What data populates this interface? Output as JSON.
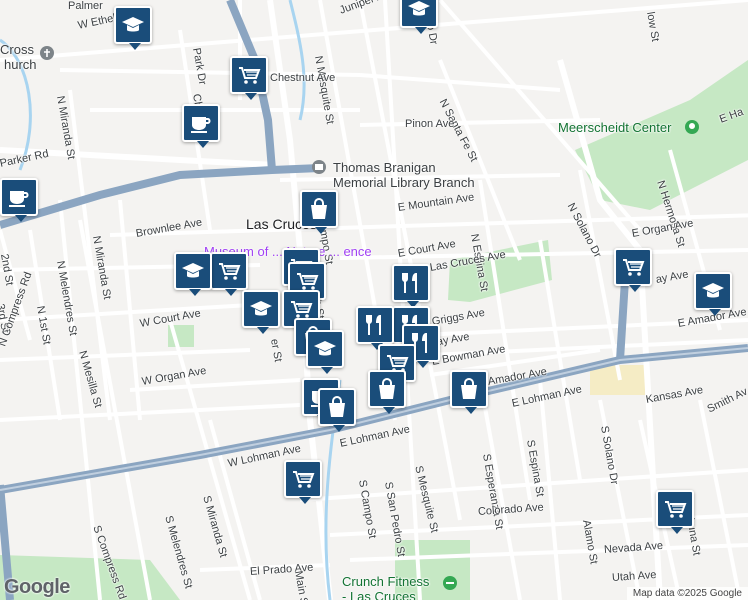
{
  "map": {
    "city_label": "Las Cruces",
    "museum_label": "Museum of ... Nature ... ence",
    "library_label_line1": "Thomas Branigan",
    "library_label_line2": "Memorial Library Branch",
    "meerscheidt_label": "Meerscheidt Center",
    "crunch_label_line1": "Crunch Fitness",
    "crunch_label_line2": "- Las Cruces",
    "cross_label_line1": "Cross",
    "cross_label_line2": "hurch",
    "google_logo": "Google",
    "attribution": "Map data ©2025 Google",
    "colors": {
      "pin": "#1a4d7a",
      "park": "#c6e8c4",
      "highway": "#8ba5c1",
      "water": "#a8d4f0"
    }
  },
  "streets": {
    "palmer": "Palmer",
    "w_ethel": "W Ethel",
    "juniper": "Juniper Ave",
    "n_mesquite": "N Mesquite St",
    "park_dr": "Park Dr",
    "chestnut": "Chestnut Ave",
    "n_miranda_top": "N Miranda St",
    "cher": "Cher",
    "n_santa_fe": "N Santa Fe St",
    "pinon": "Pinon Ave",
    "parker": "Parker Rd",
    "n_solano": "N Solano Dr",
    "n_hermosa": "N Hermosa St",
    "e_mountain": "E Mountain Ave",
    "n_espina": "N Espina St",
    "e_organ": "E Organ Ave",
    "brownlee": "Brownlee Ave",
    "n_miranda": "N Miranda St",
    "n_melendres": "N Melendres St",
    "2nd": "2nd St",
    "3rd": "3rd St",
    "n_1st": "N 1st St",
    "n_compress": "N Compress Rd",
    "n_mesilla": "N Mesilla St",
    "w_court": "W Court Ave",
    "e_court": "E Court Ave",
    "las_cruces_ave": "Las Cruces Ave",
    "e_amador": "E Amador Ave",
    "griggs": "Griggs Ave",
    "may": "May Ave",
    "w_organ": "W Organ Ave",
    "e_bowman": "E Bowman Ave",
    "amador_ave": "Amador Ave",
    "e_lohman": "E Lohman Ave",
    "e_lohman2": "E Lohman Ave",
    "w_lohman": "W Lohman Ave",
    "s_campo": "S Campo St",
    "s_san_pedro": "S San Pedro St",
    "s_mesquite": "S Mesquite St",
    "s_esperanza": "S Esperanza St",
    "s_espina": "S Espina St",
    "s_solano": "S Solano Dr",
    "kansas": "Kansas Ave",
    "smith": "Smith Av",
    "s_compress": "S Compress Rd",
    "s_melendres": "S Melendres St",
    "s_miranda": "S Miranda St",
    "colorado": "Colorado Ave",
    "alamo": "Alamo St",
    "luna": "Luna St",
    "nevada": "Nevada Ave",
    "utah": "Utah Ave",
    "el_prado": "El Prado Ave",
    "main": "Main St",
    "ampo": "ampo St",
    "ch_st": "ch St",
    "er_st": "er St",
    "ado_dr": "ado Dr",
    "low_st": "low St",
    "e_ha": "E Ha",
    "ay_ave": "ay Ave",
    "riggs": "riggs Ave"
  },
  "pins": [
    {
      "type": "school-icon"
    },
    {
      "type": "school-icon"
    },
    {
      "type": "grocery-icon"
    },
    {
      "type": "cafe-icon"
    },
    {
      "type": "cafe-icon"
    },
    {
      "type": "shopping-bag-icon"
    },
    {
      "type": "grocery-icon"
    },
    {
      "type": "restaurant-icon"
    },
    {
      "type": "school-icon"
    },
    {
      "type": "grocery-icon"
    },
    {
      "type": "grocery-icon"
    },
    {
      "type": "restaurant-icon"
    },
    {
      "type": "grocery-icon"
    },
    {
      "type": "school-icon"
    },
    {
      "type": "school-icon"
    },
    {
      "type": "grocery-icon"
    },
    {
      "type": "shopping-bag-icon"
    },
    {
      "type": "school-icon"
    },
    {
      "type": "restaurant-icon"
    },
    {
      "type": "restaurant-icon"
    },
    {
      "type": "grocery-icon"
    },
    {
      "type": "shopping-bag-icon"
    },
    {
      "type": "cafe-icon"
    },
    {
      "type": "shopping-bag-icon"
    },
    {
      "type": "shopping-bag-icon"
    },
    {
      "type": "grocery-icon"
    },
    {
      "type": "grocery-icon"
    }
  ]
}
